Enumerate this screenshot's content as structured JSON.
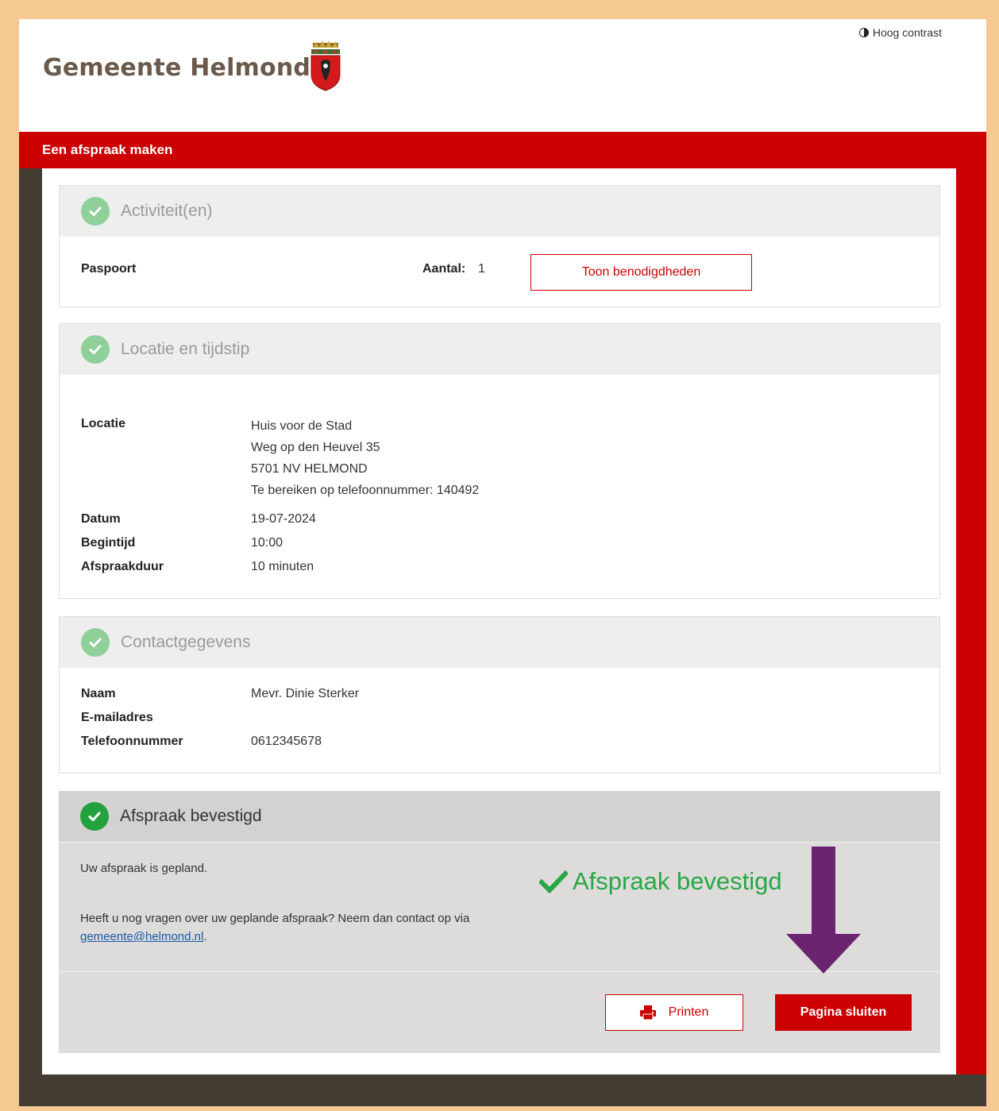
{
  "header": {
    "brand": "Gemeente Helmond",
    "contrast_label": "Hoog contrast"
  },
  "page_title": "Een afspraak maken",
  "sections": {
    "activities": {
      "title": "Activiteit(en)",
      "item": "Paspoort",
      "count_label": "Aantal:",
      "count_value": "1",
      "requirements_button": "Toon benodigdheden"
    },
    "location": {
      "title": "Locatie en tijdstip",
      "location_label": "Locatie",
      "address_lines": [
        "Huis voor de Stad",
        "Weg op den Heuvel 35",
        "5701 NV HELMOND",
        "Te bereiken op telefoonnummer: 140492"
      ],
      "date_label": "Datum",
      "date_value": "19-07-2024",
      "start_label": "Begintijd",
      "start_value": "10:00",
      "duration_label": "Afspraakduur",
      "duration_value": "10 minuten"
    },
    "contact": {
      "title": "Contactgegevens",
      "name_label": "Naam",
      "name_value": "Mevr. Dinie Sterker",
      "email_label": "E-mailadres",
      "email_value": "",
      "phone_label": "Telefoonnummer",
      "phone_value": "0612345678"
    },
    "confirmation": {
      "title": "Afspraak bevestigd",
      "planned_text": "Uw afspraak is gepland.",
      "question_text": "Heeft u nog vragen over uw geplande afspraak? Neem dan contact op via",
      "email_link": "gemeente@helmond.nl",
      "email_suffix": ".",
      "status_text": "Afspraak bevestigd",
      "print_button": "Printen",
      "close_button": "Pagina sluiten"
    }
  },
  "colors": {
    "brand_red": "#cc0000",
    "success_green": "#28a745",
    "annotation_arrow": "#6b2470"
  }
}
